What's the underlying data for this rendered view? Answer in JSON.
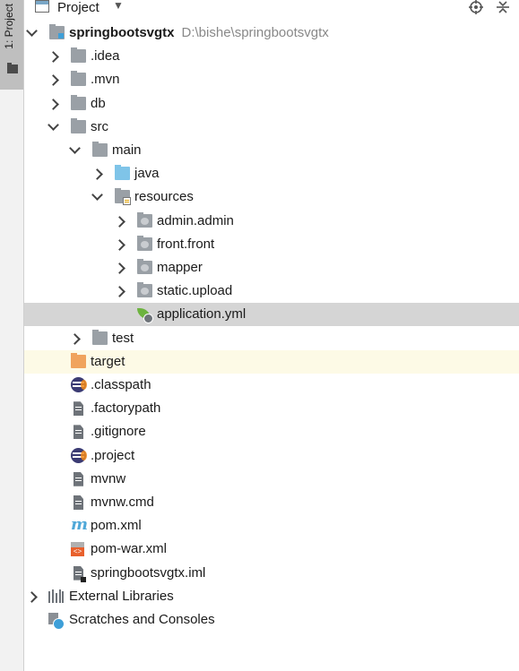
{
  "sidebar": {
    "tab_label": "1: Project"
  },
  "toolbar": {
    "title": "Project",
    "dropdown": "▼"
  },
  "tree": [
    {
      "label": "springbootsvgtx",
      "path": "D:\\bishe\\springbootsvgtx",
      "bold": true,
      "icon": "module-folder-icon",
      "arrow": "open",
      "level": 0
    },
    {
      "label": ".idea",
      "icon": "folder-icon",
      "arrow": "closed",
      "level": 1
    },
    {
      "label": ".mvn",
      "icon": "folder-icon",
      "arrow": "closed",
      "level": 1
    },
    {
      "label": "db",
      "icon": "folder-icon",
      "arrow": "closed",
      "level": 1
    },
    {
      "label": "src",
      "icon": "folder-icon",
      "arrow": "open",
      "level": 1
    },
    {
      "label": "main",
      "icon": "folder-icon",
      "arrow": "open",
      "level": 2
    },
    {
      "label": "java",
      "icon": "source-folder-icon",
      "arrow": "closed",
      "level": 3
    },
    {
      "label": "resources",
      "icon": "resources-folder-icon",
      "arrow": "open",
      "level": 3
    },
    {
      "label": "admin.admin",
      "icon": "package-folder-icon",
      "arrow": "closed",
      "level": 4
    },
    {
      "label": "front.front",
      "icon": "package-folder-icon",
      "arrow": "closed",
      "level": 4
    },
    {
      "label": "mapper",
      "icon": "package-folder-icon",
      "arrow": "closed",
      "level": 4
    },
    {
      "label": "static.upload",
      "icon": "package-folder-icon",
      "arrow": "closed",
      "level": 4
    },
    {
      "label": "application.yml",
      "icon": "spring-config-icon",
      "arrow": "none",
      "level": 4,
      "selected": true
    },
    {
      "label": "test",
      "icon": "folder-icon",
      "arrow": "closed",
      "level": 2
    },
    {
      "label": "target",
      "icon": "excluded-folder-icon",
      "arrow": "none",
      "level": 1,
      "highlight": true
    },
    {
      "label": ".classpath",
      "icon": "eclipse-icon",
      "arrow": "none",
      "level": 1
    },
    {
      "label": ".factorypath",
      "icon": "text-file-icon",
      "arrow": "none",
      "level": 1
    },
    {
      "label": ".gitignore",
      "icon": "text-file-icon",
      "arrow": "none",
      "level": 1
    },
    {
      "label": ".project",
      "icon": "eclipse-icon",
      "arrow": "none",
      "level": 1
    },
    {
      "label": "mvnw",
      "icon": "text-file-icon",
      "arrow": "none",
      "level": 1
    },
    {
      "label": "mvnw.cmd",
      "icon": "text-file-icon",
      "arrow": "none",
      "level": 1
    },
    {
      "label": "pom.xml",
      "icon": "maven-icon",
      "arrow": "none",
      "level": 1
    },
    {
      "label": "pom-war.xml",
      "icon": "xml-file-icon",
      "arrow": "none",
      "level": 1
    },
    {
      "label": "springbootsvgtx.iml",
      "icon": "iml-file-icon",
      "arrow": "none",
      "level": 1
    },
    {
      "label": "External Libraries",
      "icon": "libraries-icon",
      "arrow": "closed",
      "level": 0
    },
    {
      "label": "Scratches and Consoles",
      "icon": "scratches-icon",
      "arrow": "none",
      "level": 0
    }
  ]
}
